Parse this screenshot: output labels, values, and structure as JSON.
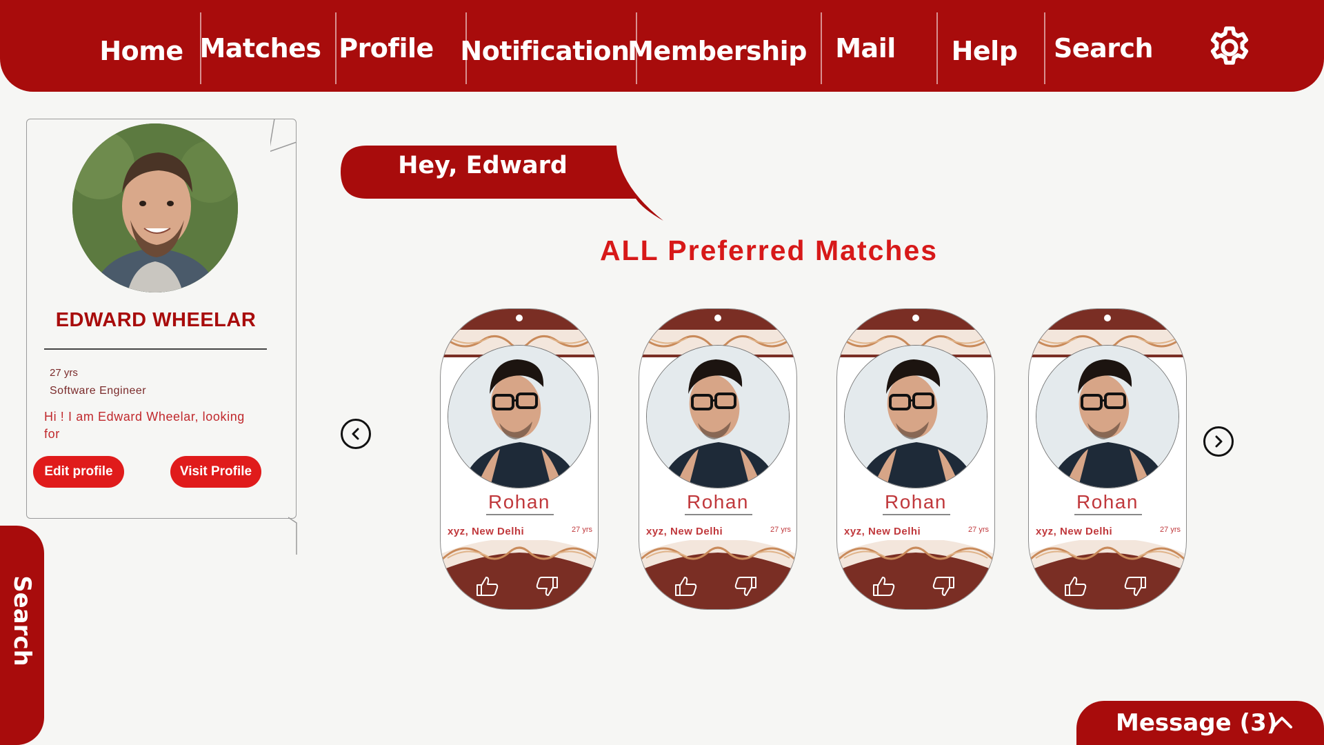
{
  "nav": {
    "items": [
      {
        "label": "Home",
        "icon": ""
      },
      {
        "label": "Matches"
      },
      {
        "label": "Profile"
      },
      {
        "label": "Notification"
      },
      {
        "label": "Membership"
      },
      {
        "label": "Mail"
      },
      {
        "label": "Help"
      },
      {
        "label": "Search"
      }
    ],
    "settings_icon": "gear-icon"
  },
  "profile": {
    "name": "EDWARD WHEELAR",
    "age": "27 yrs",
    "job": "Software Engineer",
    "bio": "Hi ! I am Edward Wheelar, looking for",
    "edit_label": "Edit profile",
    "visit_label": "Visit Profile"
  },
  "side_search": {
    "label": "Search"
  },
  "greeting": "Hey, Edward",
  "section_title": "ALL Preferred Matches",
  "matches": [
    {
      "name": "Rohan",
      "location": "xyz, New Delhi",
      "age": "27 yrs"
    },
    {
      "name": "Rohan",
      "location": "xyz, New Delhi",
      "age": "27 yrs"
    },
    {
      "name": "Rohan",
      "location": "xyz, New Delhi",
      "age": "27 yrs"
    },
    {
      "name": "Rohan",
      "location": "xyz, New Delhi",
      "age": "27 yrs"
    }
  ],
  "message": {
    "label": "Message (3)"
  },
  "colors": {
    "brand": "#a80c0c",
    "accent": "#e01b1b",
    "card_dark": "#7a2e24",
    "text_red": "#c0383c"
  }
}
